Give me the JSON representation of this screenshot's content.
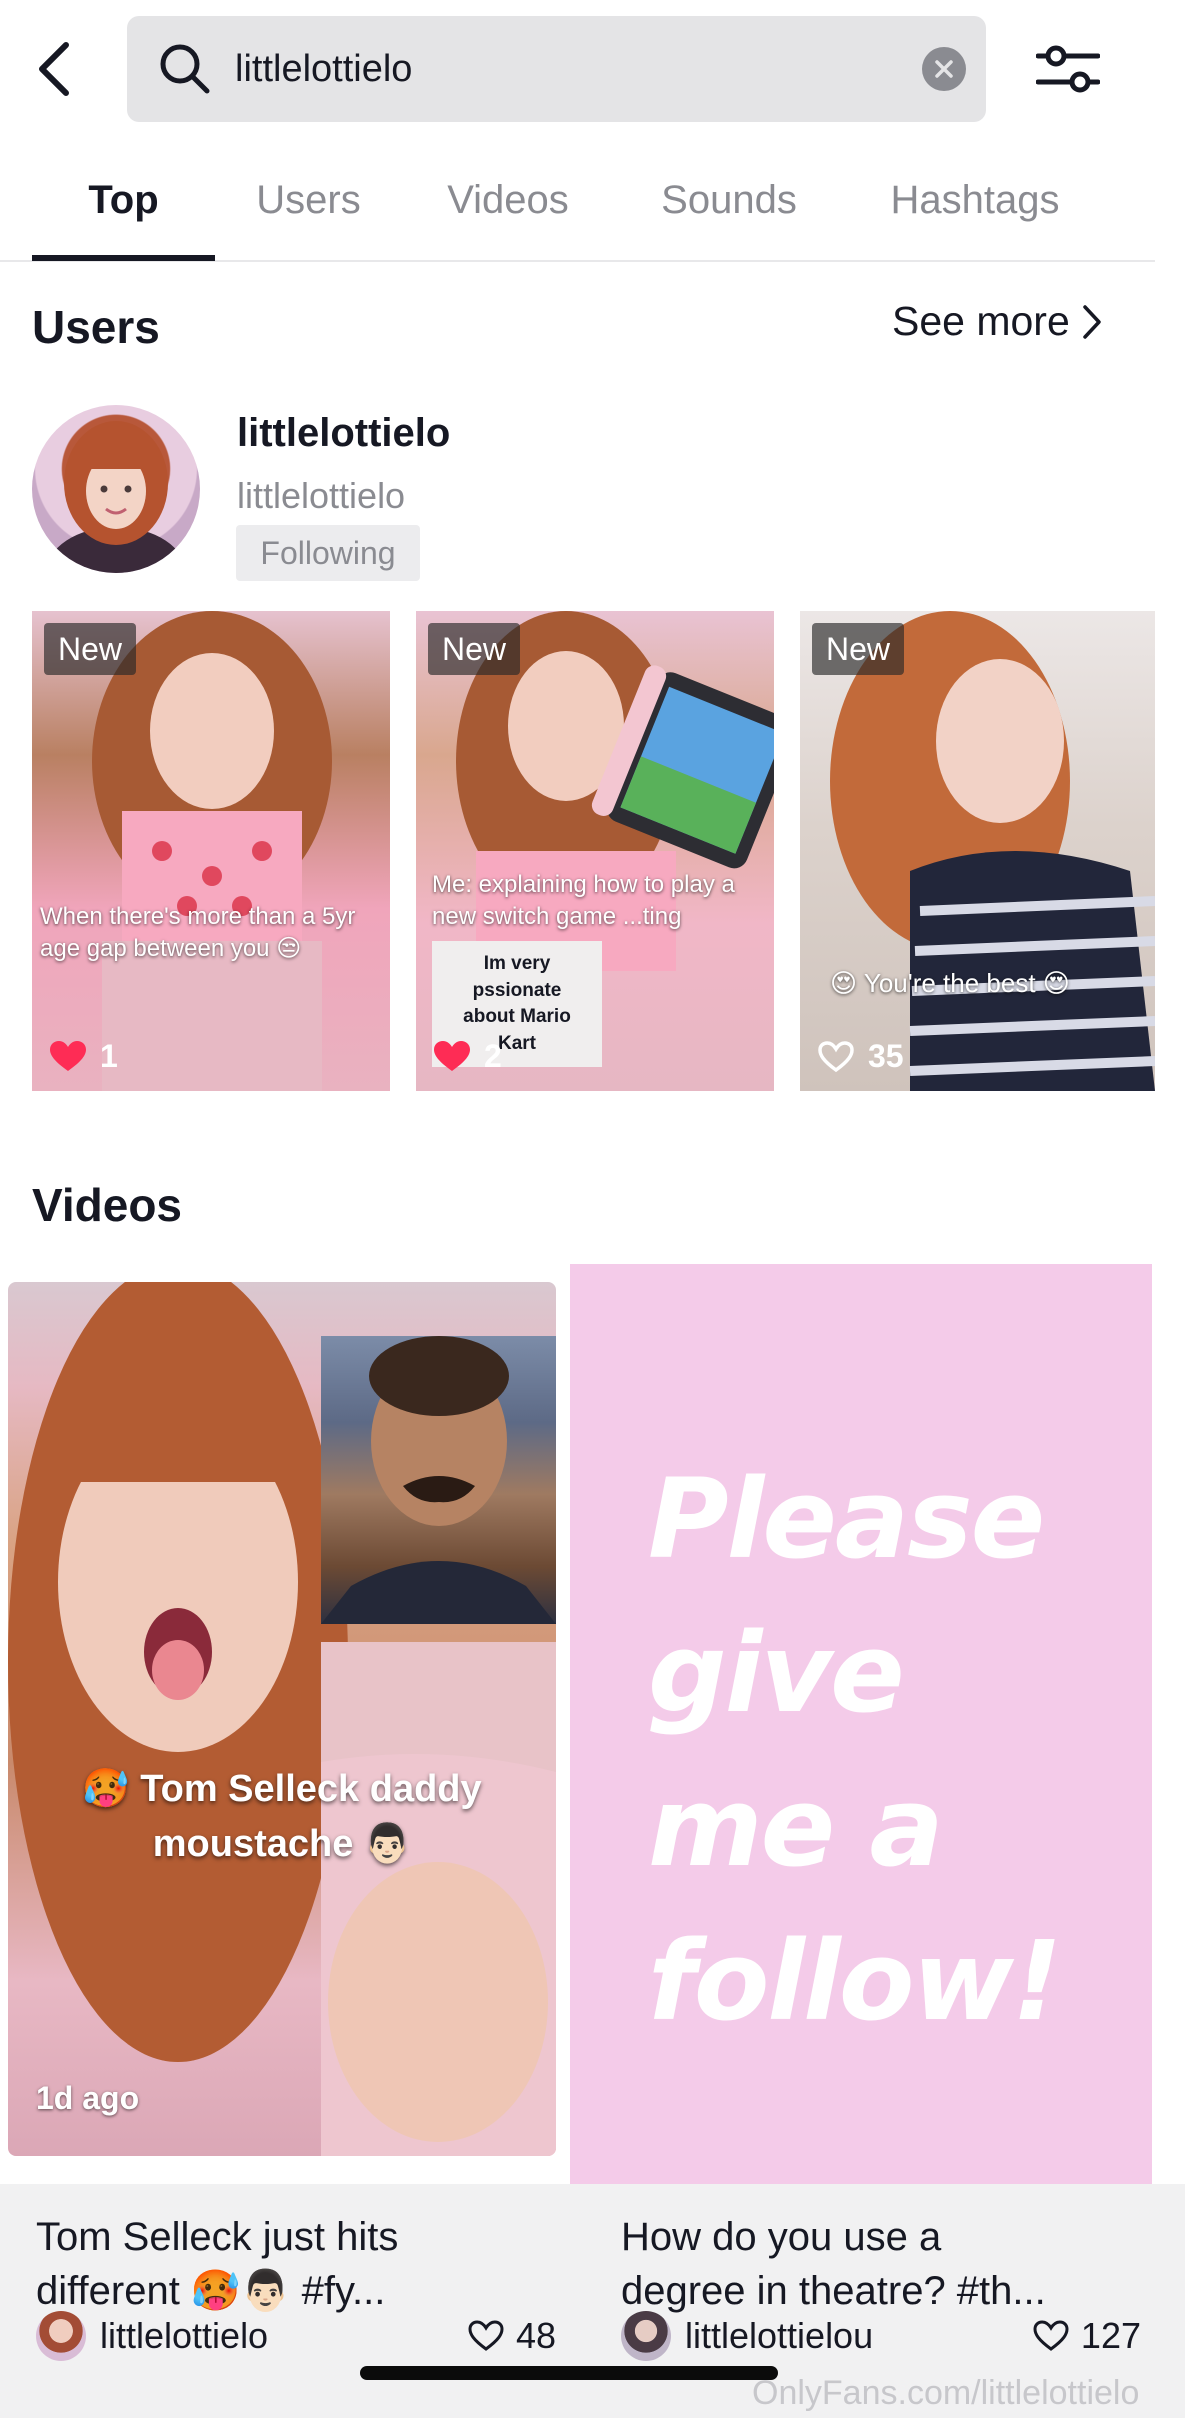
{
  "search": {
    "query": "littlelottielo"
  },
  "tabs": [
    {
      "label": "Top"
    },
    {
      "label": "Users"
    },
    {
      "label": "Videos"
    },
    {
      "label": "Sounds"
    },
    {
      "label": "Hashtags"
    }
  ],
  "active_tab": "Top",
  "users_section": {
    "title": "Users",
    "see_more": "See more",
    "user": {
      "name": "littlelottielo",
      "handle": "littlelottielo",
      "follow_status": "Following"
    },
    "videos": [
      {
        "badge": "New",
        "likes": "1",
        "liked": true,
        "caption": "When there's more than a 5yr age gap between you 😒"
      },
      {
        "badge": "New",
        "likes": "2",
        "liked": true,
        "caption": "Me: explaining how to play a new switch game ...ting",
        "sticker": "Im very pssionate about Mario Kart"
      },
      {
        "badge": "New",
        "likes": "35",
        "liked": false,
        "caption": "😍 You're the best 😍"
      }
    ]
  },
  "videos_section": {
    "title": "Videos",
    "items": [
      {
        "overlay_line1": "🥵 Tom Selleck daddy",
        "overlay_line2": "moustache 👨🏻",
        "age": "1d ago",
        "caption_line1": "Tom Selleck just hits",
        "caption_line2": "different 🥵👨🏻          #fy...",
        "author": "littlelottielo",
        "likes": "48"
      },
      {
        "text_line1": "Please",
        "text_line2": "give",
        "text_line3": "me a",
        "text_line4": "follow!",
        "caption_line1": "How do you use a",
        "caption_line2": "degree in theatre? #th...",
        "author": "littlelottielou",
        "likes": "127"
      }
    ]
  },
  "watermark": "OnlyFans.com/littlelottielo",
  "colors": {
    "text_primary": "#161823",
    "text_secondary": "#8a8b91",
    "search_bg": "#e4e4e6",
    "like_red": "#fe2c55",
    "pink_card": "#f4cbe9"
  }
}
